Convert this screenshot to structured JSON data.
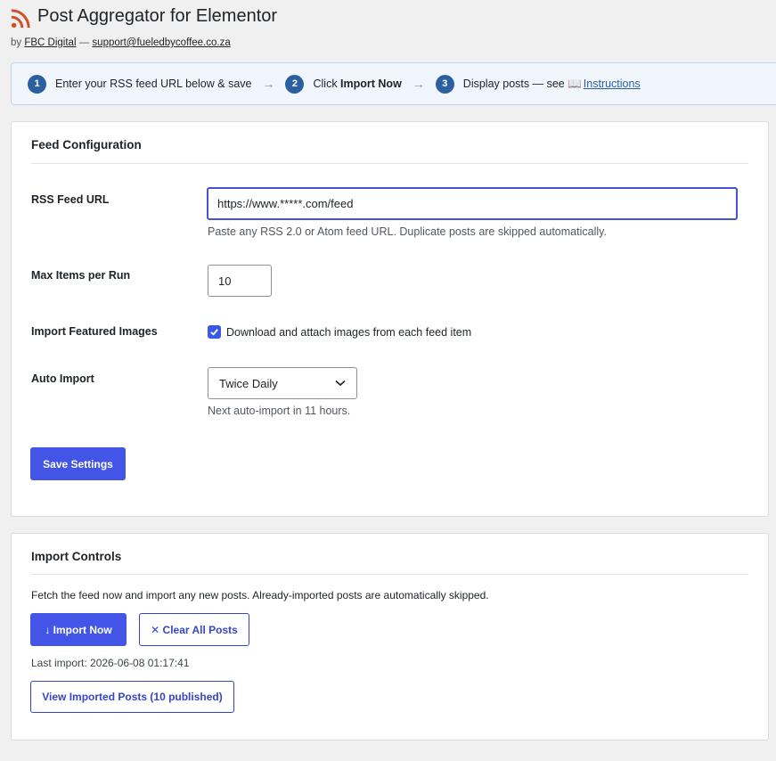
{
  "header": {
    "title": "Post Aggregator for Elementor",
    "by": "by",
    "author": "FBC Digital",
    "dash": "—",
    "email": "support@fueledbycoffee.co.za",
    "icon": "rss-icon",
    "icon_color": "#d54e21"
  },
  "steps": [
    {
      "num": "1",
      "text": "Enter your RSS feed URL below & save"
    },
    {
      "num": "2",
      "text_prefix": "Click ",
      "text_bold": "Import Now"
    },
    {
      "num": "3",
      "text_prefix": "Display posts — see ",
      "book_icon": "📖",
      "link": "Instructions"
    }
  ],
  "feed_config": {
    "title": "Feed Configuration",
    "rss_label": "RSS Feed URL",
    "rss_value": "https://www.*****.com/feed",
    "rss_hint": "Paste any RSS 2.0 or Atom feed URL. Duplicate posts are skipped automatically.",
    "max_label": "Max Items per Run",
    "max_value": "10",
    "images_label": "Import Featured Images",
    "images_checked": true,
    "images_checkbox_label": "Download and attach images from each feed item",
    "auto_label": "Auto Import",
    "auto_value": "Twice Daily",
    "auto_hint": "Next auto-import in 11 hours.",
    "save_button": "Save Settings"
  },
  "import_controls": {
    "title": "Import Controls",
    "description": "Fetch the feed now and import any new posts. Already-imported posts are automatically skipped.",
    "import_button": "↓ Import Now",
    "clear_button": "✕ Clear All Posts",
    "last_import": "Last import: 2026-06-08 01:17:41",
    "view_button": "View Imported Posts (10 published)"
  },
  "colors": {
    "accent": "#4355e6",
    "step_badge": "#2c5fa0",
    "background": "#f0f0f1"
  }
}
